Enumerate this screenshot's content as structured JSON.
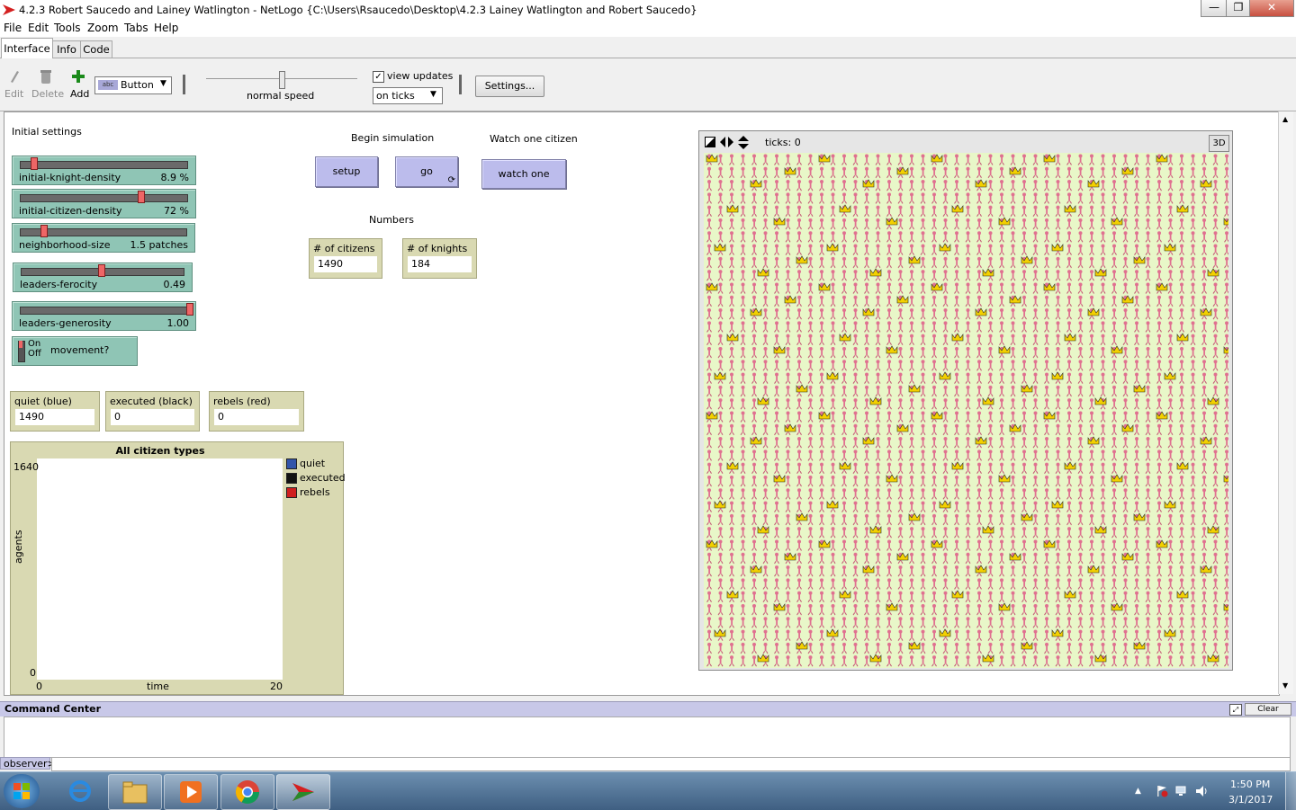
{
  "window": {
    "title": "4.2.3 Robert Saucedo and Lainey Watlington - NetLogo {C:\\Users\\Rsaucedo\\Desktop\\4.2.3 Lainey Watlington and Robert Saucedo}",
    "minimize": "—",
    "restore": "❐",
    "close": "✕"
  },
  "menu": [
    "File",
    "Edit",
    "Tools",
    "Zoom",
    "Tabs",
    "Help"
  ],
  "tabs": [
    "Interface",
    "Info",
    "Code"
  ],
  "toolbar": {
    "edit": "Edit",
    "delete": "Delete",
    "add": "Add",
    "widget_type": "Button",
    "speed_label": "normal speed",
    "view_updates": "view updates",
    "update_mode": "on ticks",
    "settings": "Settings..."
  },
  "interface": {
    "initial_settings": "Initial settings",
    "begin_simulation": "Begin simulation",
    "watch_one_citizen": "Watch one citizen",
    "numbers": "Numbers",
    "sliders": [
      {
        "label": "initial-knight-density",
        "value": "8.9 %",
        "fraction": 0.09
      },
      {
        "label": "initial-citizen-density",
        "value": "72 %",
        "fraction": 0.72
      },
      {
        "label": "neighborhood-size",
        "value": "1.5 patches",
        "fraction": 0.14
      },
      {
        "label": "leaders-ferocity",
        "value": "0.49",
        "fraction": 0.49
      },
      {
        "label": "leaders-generosity",
        "value": "1.00",
        "fraction": 1.0
      }
    ],
    "switch": {
      "on": "On",
      "off": "Off",
      "label": "movement?"
    },
    "buttons": {
      "setup": "setup",
      "go": "go",
      "watch_one": "watch one"
    },
    "monitors": {
      "citizens_label": "# of citizens",
      "citizens_value": "1490",
      "knights_label": "# of knights",
      "knights_value": "184",
      "quiet_label": "quiet (blue)",
      "quiet_value": "1490",
      "executed_label": "executed (black)",
      "executed_value": "0",
      "rebels_label": "rebels (red)",
      "rebels_value": "0"
    },
    "plot": {
      "title": "All citizen types",
      "ymax": "1640",
      "ymin": "0",
      "xmin": "0",
      "xmax": "20",
      "xlabel": "time",
      "ylabel": "agents",
      "legend": [
        {
          "name": "quiet",
          "color": "#3355aa"
        },
        {
          "name": "executed",
          "color": "#111111"
        },
        {
          "name": "rebels",
          "color": "#d02020"
        }
      ]
    },
    "world": {
      "ticks": "ticks: 0",
      "three_d": "3D"
    }
  },
  "command_center": {
    "title": "Command Center",
    "clear": "Clear",
    "prompt": "observer>"
  },
  "taskbar": {
    "time": "1:50 PM",
    "date": "3/1/2017"
  }
}
